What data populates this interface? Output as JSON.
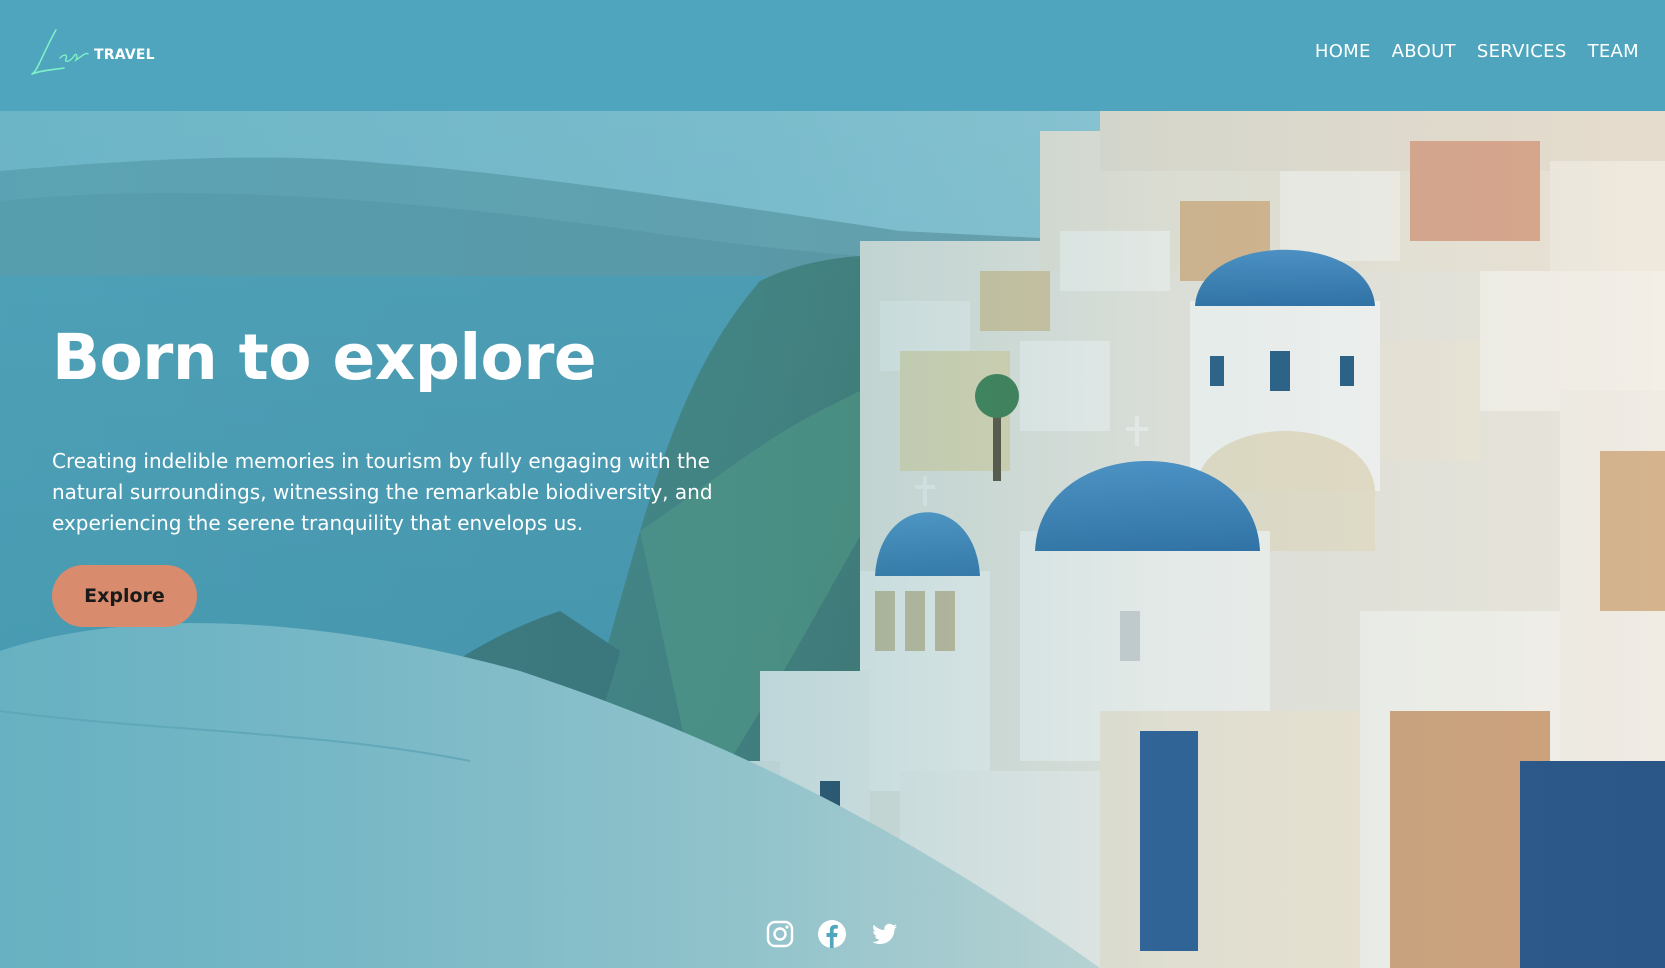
{
  "brand": {
    "script": "Lets",
    "name": "TRAVEL"
  },
  "nav": {
    "items": [
      {
        "label": "HOME"
      },
      {
        "label": "ABOUT"
      },
      {
        "label": "SERVICES"
      },
      {
        "label": "TEAM"
      }
    ]
  },
  "hero": {
    "title": "Born to explore",
    "description": "Creating indelible memories in tourism by fully engaging with the natural surroundings, witnessing the remarkable biodiversity, and experiencing the serene tranquility that envelops us.",
    "cta_label": "Explore",
    "cta_color": "#d98b6d",
    "overlay_color": "#4fa6bd"
  },
  "social": {
    "icons": [
      "instagram-icon",
      "facebook-icon",
      "twitter-icon"
    ]
  }
}
